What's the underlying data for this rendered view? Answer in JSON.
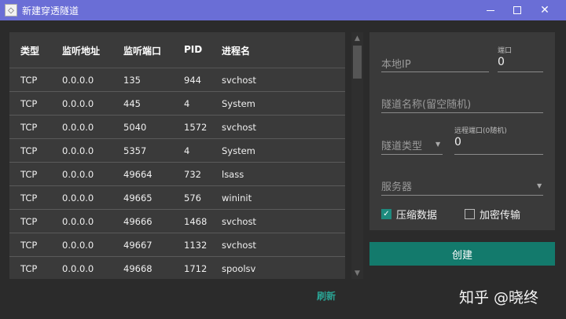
{
  "window": {
    "title": "新建穿透隧道",
    "minimize": "—",
    "maximize": "☐",
    "close": "✕"
  },
  "table": {
    "headers": [
      "类型",
      "监听地址",
      "监听端口",
      "PID",
      "进程名"
    ],
    "rows": [
      [
        "TCP",
        "0.0.0.0",
        "135",
        "944",
        "svchost"
      ],
      [
        "TCP",
        "0.0.0.0",
        "445",
        "4",
        "System"
      ],
      [
        "TCP",
        "0.0.0.0",
        "5040",
        "1572",
        "svchost"
      ],
      [
        "TCP",
        "0.0.0.0",
        "5357",
        "4",
        "System"
      ],
      [
        "TCP",
        "0.0.0.0",
        "49664",
        "732",
        "lsass"
      ],
      [
        "TCP",
        "0.0.0.0",
        "49665",
        "576",
        "wininit"
      ],
      [
        "TCP",
        "0.0.0.0",
        "49666",
        "1468",
        "svchost"
      ],
      [
        "TCP",
        "0.0.0.0",
        "49667",
        "1132",
        "svchost"
      ],
      [
        "TCP",
        "0.0.0.0",
        "49668",
        "1712",
        "spoolsv"
      ]
    ]
  },
  "refresh_label": "刷新",
  "form": {
    "local_ip_placeholder": "本地IP",
    "port_label": "端口",
    "port_value": "0",
    "tunnel_name_placeholder": "隧道名称(留空随机)",
    "tunnel_type_placeholder": "隧道类型",
    "remote_port_label": "远程端口(0随机)",
    "remote_port_value": "0",
    "server_placeholder": "服务器",
    "compress_label": "压缩数据",
    "compress_checked": true,
    "encrypt_label": "加密传输",
    "encrypt_checked": false,
    "create_label": "创建"
  },
  "watermark": "知乎 @晓终",
  "colors": {
    "titlebar": "#6a6ed6",
    "accent": "#137a6c",
    "refresh": "#2aa394"
  }
}
